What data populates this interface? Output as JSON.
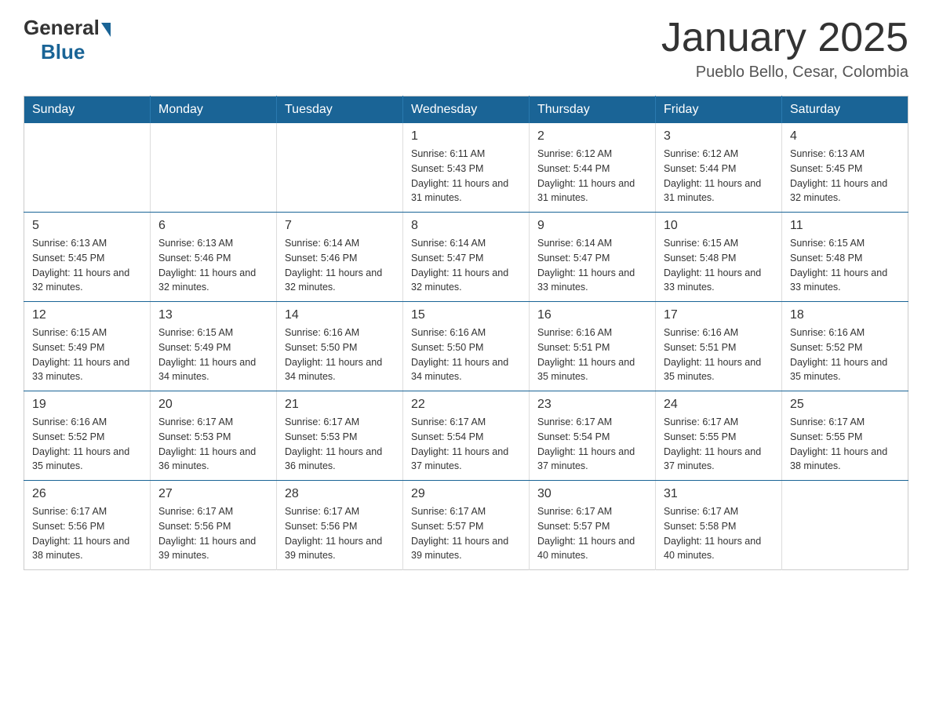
{
  "logo": {
    "general": "General",
    "blue": "Blue"
  },
  "title": "January 2025",
  "location": "Pueblo Bello, Cesar, Colombia",
  "days_of_week": [
    "Sunday",
    "Monday",
    "Tuesday",
    "Wednesday",
    "Thursday",
    "Friday",
    "Saturday"
  ],
  "weeks": [
    [
      {
        "day": "",
        "info": ""
      },
      {
        "day": "",
        "info": ""
      },
      {
        "day": "",
        "info": ""
      },
      {
        "day": "1",
        "info": "Sunrise: 6:11 AM\nSunset: 5:43 PM\nDaylight: 11 hours and 31 minutes."
      },
      {
        "day": "2",
        "info": "Sunrise: 6:12 AM\nSunset: 5:44 PM\nDaylight: 11 hours and 31 minutes."
      },
      {
        "day": "3",
        "info": "Sunrise: 6:12 AM\nSunset: 5:44 PM\nDaylight: 11 hours and 31 minutes."
      },
      {
        "day": "4",
        "info": "Sunrise: 6:13 AM\nSunset: 5:45 PM\nDaylight: 11 hours and 32 minutes."
      }
    ],
    [
      {
        "day": "5",
        "info": "Sunrise: 6:13 AM\nSunset: 5:45 PM\nDaylight: 11 hours and 32 minutes."
      },
      {
        "day": "6",
        "info": "Sunrise: 6:13 AM\nSunset: 5:46 PM\nDaylight: 11 hours and 32 minutes."
      },
      {
        "day": "7",
        "info": "Sunrise: 6:14 AM\nSunset: 5:46 PM\nDaylight: 11 hours and 32 minutes."
      },
      {
        "day": "8",
        "info": "Sunrise: 6:14 AM\nSunset: 5:47 PM\nDaylight: 11 hours and 32 minutes."
      },
      {
        "day": "9",
        "info": "Sunrise: 6:14 AM\nSunset: 5:47 PM\nDaylight: 11 hours and 33 minutes."
      },
      {
        "day": "10",
        "info": "Sunrise: 6:15 AM\nSunset: 5:48 PM\nDaylight: 11 hours and 33 minutes."
      },
      {
        "day": "11",
        "info": "Sunrise: 6:15 AM\nSunset: 5:48 PM\nDaylight: 11 hours and 33 minutes."
      }
    ],
    [
      {
        "day": "12",
        "info": "Sunrise: 6:15 AM\nSunset: 5:49 PM\nDaylight: 11 hours and 33 minutes."
      },
      {
        "day": "13",
        "info": "Sunrise: 6:15 AM\nSunset: 5:49 PM\nDaylight: 11 hours and 34 minutes."
      },
      {
        "day": "14",
        "info": "Sunrise: 6:16 AM\nSunset: 5:50 PM\nDaylight: 11 hours and 34 minutes."
      },
      {
        "day": "15",
        "info": "Sunrise: 6:16 AM\nSunset: 5:50 PM\nDaylight: 11 hours and 34 minutes."
      },
      {
        "day": "16",
        "info": "Sunrise: 6:16 AM\nSunset: 5:51 PM\nDaylight: 11 hours and 35 minutes."
      },
      {
        "day": "17",
        "info": "Sunrise: 6:16 AM\nSunset: 5:51 PM\nDaylight: 11 hours and 35 minutes."
      },
      {
        "day": "18",
        "info": "Sunrise: 6:16 AM\nSunset: 5:52 PM\nDaylight: 11 hours and 35 minutes."
      }
    ],
    [
      {
        "day": "19",
        "info": "Sunrise: 6:16 AM\nSunset: 5:52 PM\nDaylight: 11 hours and 35 minutes."
      },
      {
        "day": "20",
        "info": "Sunrise: 6:17 AM\nSunset: 5:53 PM\nDaylight: 11 hours and 36 minutes."
      },
      {
        "day": "21",
        "info": "Sunrise: 6:17 AM\nSunset: 5:53 PM\nDaylight: 11 hours and 36 minutes."
      },
      {
        "day": "22",
        "info": "Sunrise: 6:17 AM\nSunset: 5:54 PM\nDaylight: 11 hours and 37 minutes."
      },
      {
        "day": "23",
        "info": "Sunrise: 6:17 AM\nSunset: 5:54 PM\nDaylight: 11 hours and 37 minutes."
      },
      {
        "day": "24",
        "info": "Sunrise: 6:17 AM\nSunset: 5:55 PM\nDaylight: 11 hours and 37 minutes."
      },
      {
        "day": "25",
        "info": "Sunrise: 6:17 AM\nSunset: 5:55 PM\nDaylight: 11 hours and 38 minutes."
      }
    ],
    [
      {
        "day": "26",
        "info": "Sunrise: 6:17 AM\nSunset: 5:56 PM\nDaylight: 11 hours and 38 minutes."
      },
      {
        "day": "27",
        "info": "Sunrise: 6:17 AM\nSunset: 5:56 PM\nDaylight: 11 hours and 39 minutes."
      },
      {
        "day": "28",
        "info": "Sunrise: 6:17 AM\nSunset: 5:56 PM\nDaylight: 11 hours and 39 minutes."
      },
      {
        "day": "29",
        "info": "Sunrise: 6:17 AM\nSunset: 5:57 PM\nDaylight: 11 hours and 39 minutes."
      },
      {
        "day": "30",
        "info": "Sunrise: 6:17 AM\nSunset: 5:57 PM\nDaylight: 11 hours and 40 minutes."
      },
      {
        "day": "31",
        "info": "Sunrise: 6:17 AM\nSunset: 5:58 PM\nDaylight: 11 hours and 40 minutes."
      },
      {
        "day": "",
        "info": ""
      }
    ]
  ]
}
